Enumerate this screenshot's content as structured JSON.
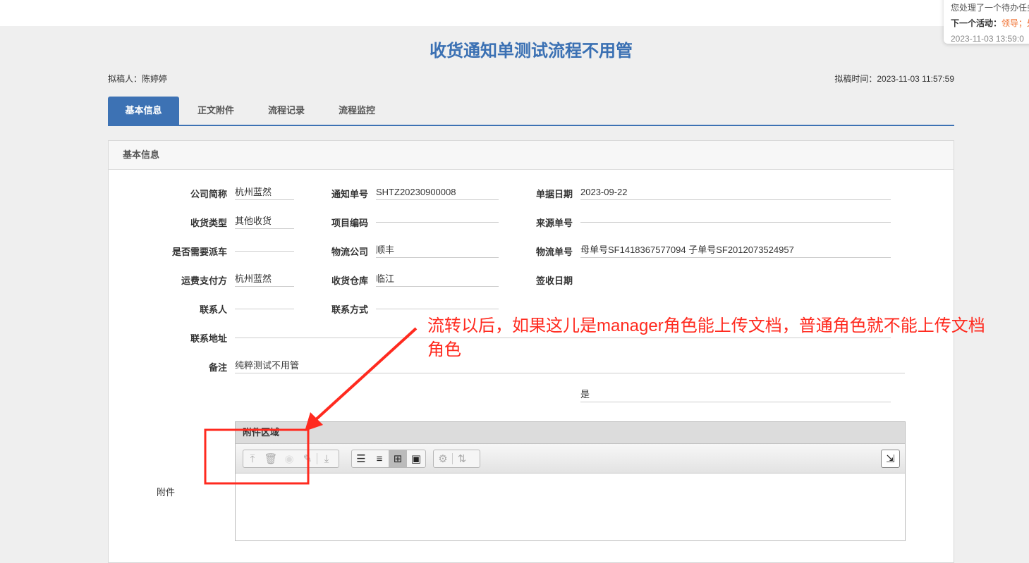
{
  "notification": {
    "line1": "您处理了一个待办任务",
    "next_label": "下一个活动：",
    "next_value": "领导；处",
    "time": "2023-11-03 13:59:0"
  },
  "header": {
    "title": "收货通知单测试流程不用管",
    "drafter": "拟稿人：陈婷婷",
    "draft_time": "拟稿时间：2023-11-03 11:57:59"
  },
  "tabs": [
    "基本信息",
    "正文附件",
    "流程记录",
    "流程监控"
  ],
  "panel_title": "基本信息",
  "form": {
    "company_label": "公司简称",
    "company": "杭州蓝然",
    "notice_no_label": "通知单号",
    "notice_no": "SHTZ20230900008",
    "date_label": "单据日期",
    "date": "2023-09-22",
    "recv_type_label": "收货类型",
    "recv_type": "其他收货",
    "project_label": "项目编码",
    "project": "",
    "source_label": "来源单号",
    "source": "",
    "dispatch_label": "是否需要派车",
    "dispatch": "",
    "logistics_label": "物流公司",
    "logistics": "顺丰",
    "tracking_label": "物流单号",
    "tracking": "母单号SF1418367577094 子单号SF2012073524957",
    "payer_label": "运费支付方",
    "payer": "杭州蓝然",
    "warehouse_label": "收货仓库",
    "warehouse": "临江",
    "sign_date_label": "签收日期",
    "contact_label": "联系人",
    "contact": "",
    "phone_label": "联系方式",
    "phone": "",
    "address_label": "联系地址",
    "address": "",
    "remark_label": "备注",
    "remark": "纯粹测试不用管",
    "flag": "是",
    "attach_label": "附件"
  },
  "attachment": {
    "title": "附件区域"
  },
  "annotation": {
    "line1": "流转以后，如果这儿是manager角色能上传文档，普通角色就不能上传文档",
    "line2": "角色"
  },
  "colors": {
    "accent": "#3d72b4",
    "annotation": "#ff2a1f"
  }
}
